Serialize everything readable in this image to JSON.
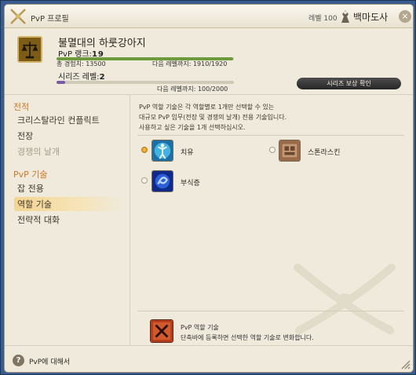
{
  "window": {
    "title": "PvP 프로필",
    "title_icon": "crossed-swords-icon",
    "level_label": "레벨 100",
    "job_icon": "white-mage-job-icon",
    "job_name": "백마도사",
    "close_icon": "close-icon"
  },
  "profile": {
    "emblem_icon": "scales-emblem-icon",
    "player_name": "불멸대의 하룻강아지",
    "rank_label": "PvP 랭크:",
    "rank_value": "19",
    "total_exp": "총 경험치: 13500",
    "next_level_exp": "다음 레벨까지: 1910/1920",
    "rank_progress": 0.995,
    "series_label": "시리즈 레벨:",
    "series_value": "2",
    "series_next": "다음 레벨까지: 100/2000",
    "series_progress": 0.05,
    "series_reward_button": "시리즈 보상 확인"
  },
  "sidebar": {
    "section1": "전적",
    "items1": [
      "크리스탈라인 컨플릭트",
      "전장",
      "경쟁의 날개"
    ],
    "section2": "PvP 기술",
    "items2": [
      "잡 전용",
      "역할 기술",
      "전략적 대화"
    ],
    "selected": "역할 기술"
  },
  "main": {
    "description": [
      "PvP 역할 기술은 각 역할별로 1개만 선택할 수 있는",
      "대규모 PvP 임무(전장 및 경쟁의 날개) 전용 기술입니다.",
      "사용하고 싶은 기술을 1개 선택하십시오."
    ],
    "skills": [
      {
        "label": "치유",
        "icon": "healing-figure-icon",
        "selected": true
      },
      {
        "label": "스톤라스킨",
        "icon": "stoneskin-icon",
        "selected": false
      },
      {
        "label": "부식증",
        "icon": "blue-swirl-icon",
        "selected": false
      }
    ],
    "footer_icon": "crossed-swords-red-icon",
    "footer_title": "PvP 역할 기술",
    "footer_desc": "단축바에 등록하면 선택한 역할 기술로 변화합니다."
  },
  "bottom": {
    "help_label": "PvP에 대해서"
  },
  "colors": {
    "accent_orange": "#c97a2a",
    "rank_bar": "#6d9a3c",
    "series_bar": "#7a5aa6",
    "panel_bg": "#efeadc"
  }
}
